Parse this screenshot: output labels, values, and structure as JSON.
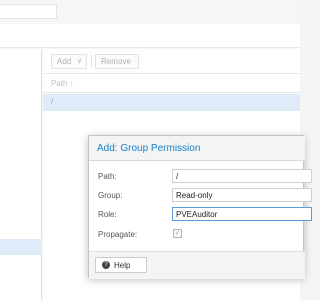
{
  "toolbar": {
    "add_label": "Add",
    "add_caret": "∨",
    "remove_label": "Remove"
  },
  "grid": {
    "columns": [
      {
        "label": "Path ↑"
      }
    ],
    "rows": [
      {
        "path": "/"
      }
    ]
  },
  "dialog": {
    "title": "Add: Group Permission",
    "fields": {
      "path": {
        "label": "Path:",
        "value": "/"
      },
      "group": {
        "label": "Group:",
        "value": "Read-only"
      },
      "role": {
        "label": "Role:",
        "value": "PVEAuditor"
      },
      "propagate": {
        "label": "Propagate:",
        "checked": true,
        "check_glyph": "✓"
      }
    },
    "help_label": "Help",
    "help_icon": "?"
  },
  "colors": {
    "accent": "#157fcc",
    "selection": "#dbe9f7",
    "focus_border": "#5b9bd5"
  },
  "icons": {
    "help": "help-circle-icon",
    "checkbox": "checkmark-icon",
    "dropdown": "chevron-down-icon"
  }
}
